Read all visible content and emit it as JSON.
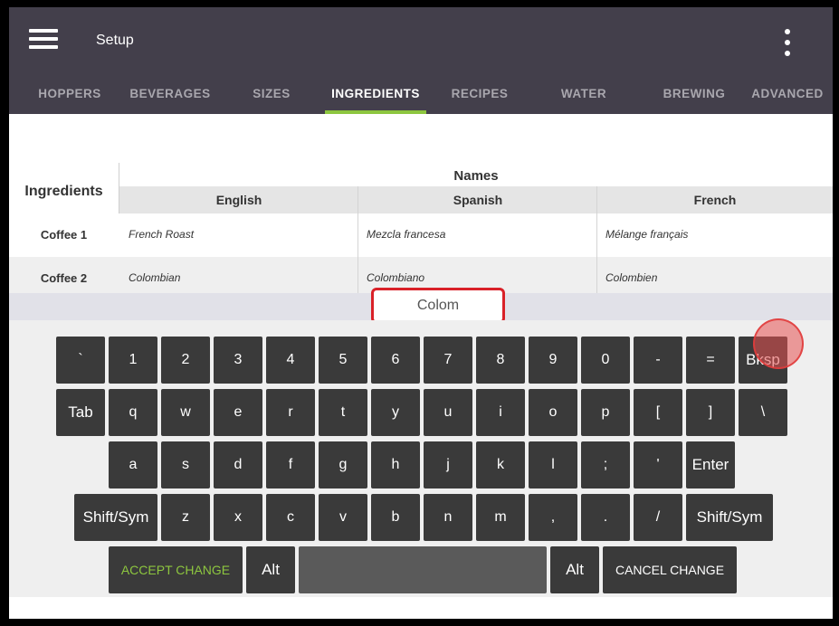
{
  "app": {
    "title": "Setup"
  },
  "tabs": [
    {
      "label": "HOPPERS"
    },
    {
      "label": "BEVERAGES"
    },
    {
      "label": "SIZES"
    },
    {
      "label": "INGREDIENTS",
      "active": true
    },
    {
      "label": "RECIPES"
    },
    {
      "label": "WATER"
    },
    {
      "label": "BREWING"
    },
    {
      "label": "ADVANCED"
    }
  ],
  "table": {
    "ingredients_header": "Ingredients",
    "names_header": "Names",
    "languages": [
      "English",
      "Spanish",
      "French"
    ],
    "rows": [
      {
        "label": "Coffee 1",
        "english": "French Roast",
        "spanish": "Mezcla francesa",
        "french": "Mélange français"
      },
      {
        "label": "Coffee 2",
        "english": "Colombian",
        "spanish": "Colombiano",
        "french": "Colombien"
      }
    ]
  },
  "edit": {
    "value": "Colom"
  },
  "keyboard": {
    "row1": [
      "`",
      "1",
      "2",
      "3",
      "4",
      "5",
      "6",
      "7",
      "8",
      "9",
      "0",
      "-",
      "=",
      "Bksp"
    ],
    "row2": [
      "Tab",
      "q",
      "w",
      "e",
      "r",
      "t",
      "y",
      "u",
      "i",
      "o",
      "p",
      "[",
      "]",
      "\\"
    ],
    "row3": [
      "a",
      "s",
      "d",
      "f",
      "g",
      "h",
      "j",
      "k",
      "l",
      ";",
      "'",
      "Enter"
    ],
    "row4": [
      "Shift/Sym",
      "z",
      "x",
      "c",
      "v",
      "b",
      "n",
      "m",
      ",",
      ".",
      "/",
      "Shift/Sym"
    ],
    "row5": {
      "accept": "ACCEPT CHANGE",
      "alt_left": "Alt",
      "alt_right": "Alt",
      "cancel": "CANCEL CHANGE"
    }
  },
  "colors": {
    "app_bar": "#433f4b",
    "tab_indicator": "#8dc63f",
    "accept_text": "#8dc63f",
    "edit_border": "#d92128",
    "key_bg": "#3a3a3a"
  }
}
